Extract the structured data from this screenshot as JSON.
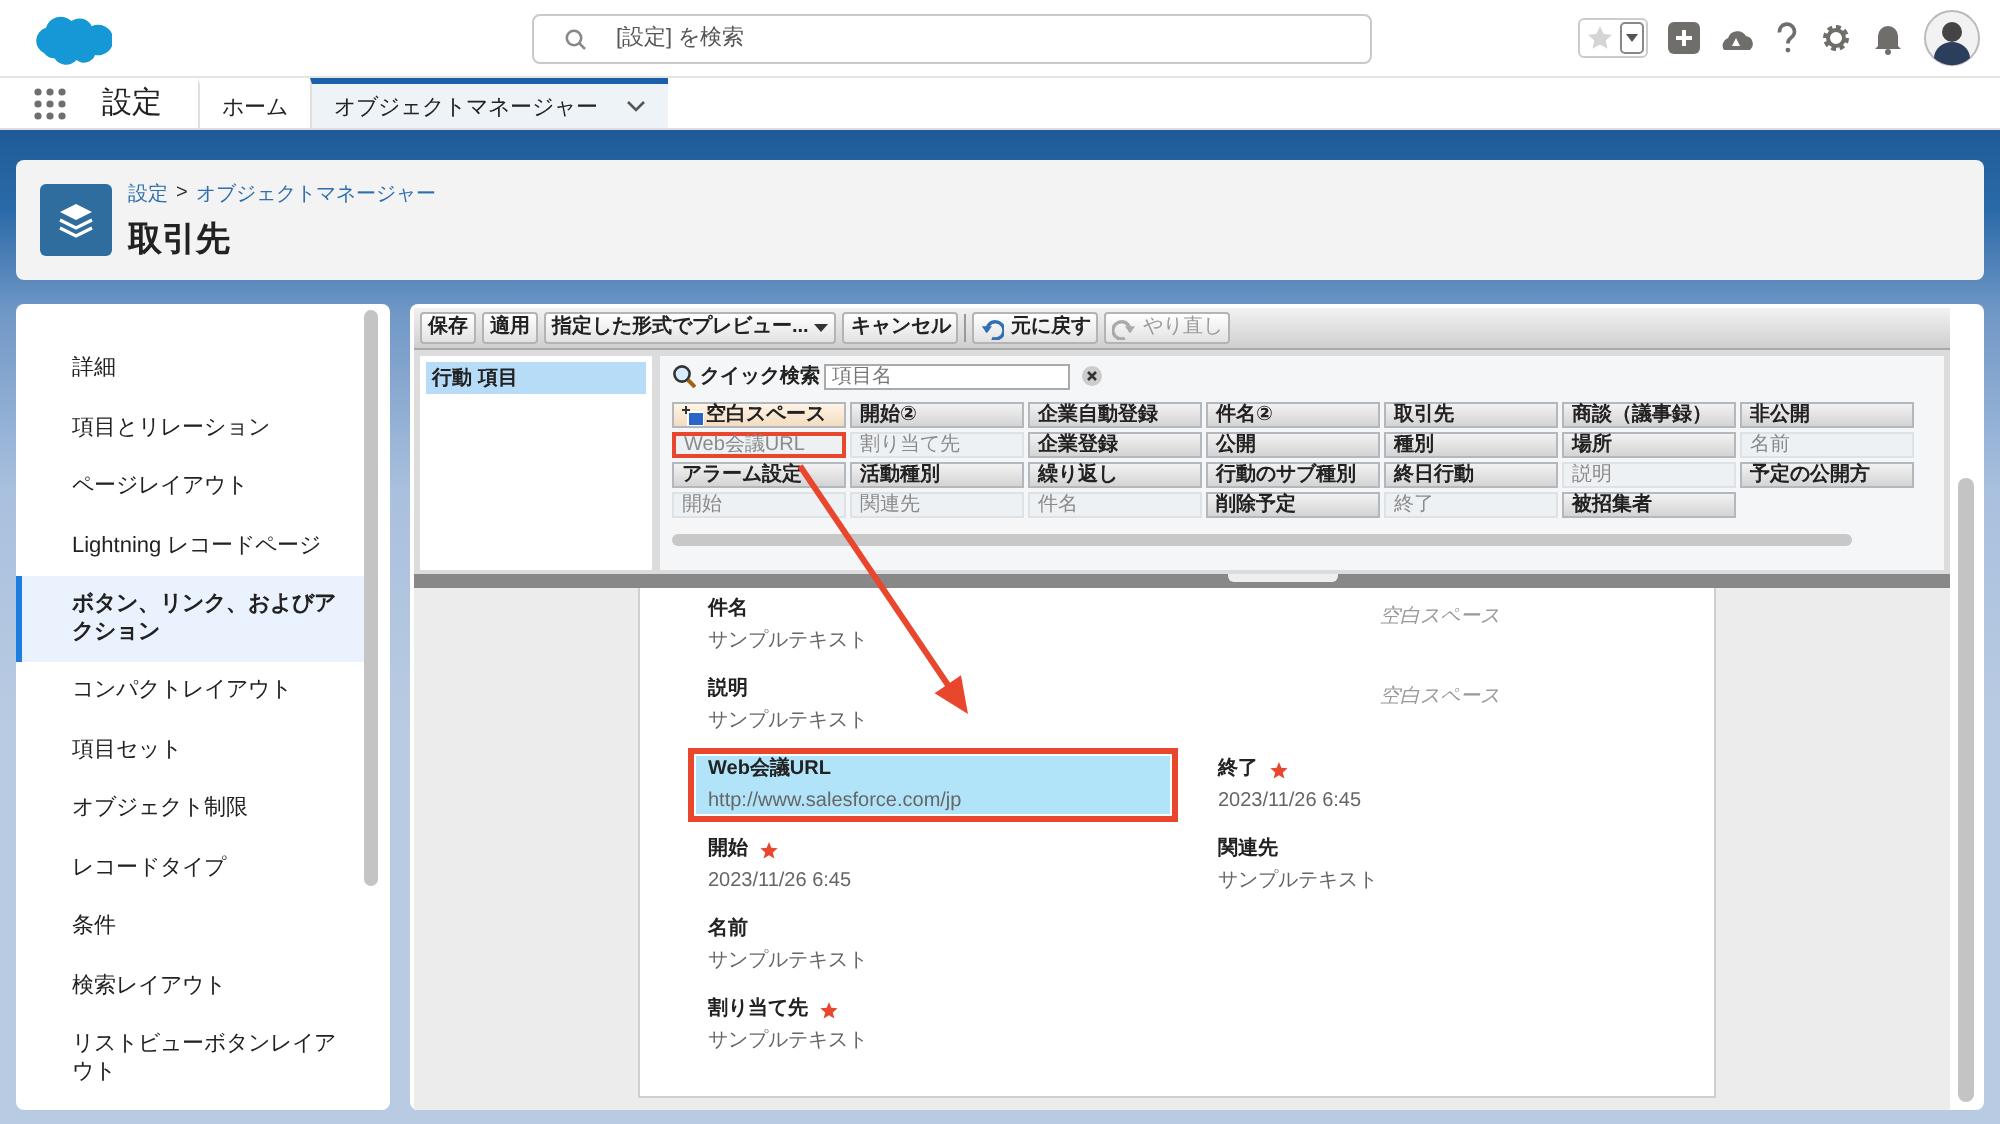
{
  "top_bar": {
    "search_placeholder": "[設定] を検索"
  },
  "nav": {
    "app_name": "設定",
    "tabs": [
      {
        "label": "ホーム",
        "selected": false,
        "has_menu": false
      },
      {
        "label": "オブジェクトマネージャー",
        "selected": true,
        "has_menu": true
      }
    ]
  },
  "page_header": {
    "breadcrumb": [
      "設定",
      "オブジェクトマネージャー"
    ],
    "separator": ">",
    "title": "取引先"
  },
  "sidebar": {
    "items": [
      {
        "label": "詳細",
        "selected": false
      },
      {
        "label": "項目とリレーション",
        "selected": false
      },
      {
        "label": "ページレイアウト",
        "selected": false
      },
      {
        "label": "Lightning レコードページ",
        "selected": false
      },
      {
        "label": "ボタン、リンク、およびアクション",
        "selected": true
      },
      {
        "label": "コンパクトレイアウト",
        "selected": false
      },
      {
        "label": "項目セット",
        "selected": false
      },
      {
        "label": "オブジェクト制限",
        "selected": false
      },
      {
        "label": "レコードタイプ",
        "selected": false
      },
      {
        "label": "条件",
        "selected": false
      },
      {
        "label": "検索レイアウト",
        "selected": false
      },
      {
        "label": "リストビューボタンレイアウト",
        "selected": false
      }
    ]
  },
  "palette": {
    "toolbar": [
      {
        "label": "保存",
        "kind": "button",
        "disabled": false
      },
      {
        "label": "適用",
        "kind": "button",
        "disabled": false
      },
      {
        "label": "指定した形式でプレビュー...",
        "kind": "dropdown",
        "disabled": false
      },
      {
        "label": "キャンセル",
        "kind": "button",
        "disabled": false
      },
      {
        "label": "元に戻す",
        "kind": "undo",
        "disabled": false
      },
      {
        "label": "やり直し",
        "kind": "redo",
        "disabled": true
      }
    ],
    "categories": [
      {
        "label": "行動 項目",
        "selected": true
      }
    ],
    "quick_search": {
      "label": "クイック検索",
      "placeholder": "項目名"
    },
    "items": [
      {
        "label": "空白スペース",
        "kind": "blank",
        "used": false,
        "annotated": false
      },
      {
        "label": "開始②",
        "kind": "field",
        "used": false,
        "annotated": false
      },
      {
        "label": "企業自動登録",
        "kind": "field",
        "used": false,
        "annotated": false
      },
      {
        "label": "件名②",
        "kind": "field",
        "used": false,
        "annotated": false
      },
      {
        "label": "取引先",
        "kind": "field",
        "used": false,
        "annotated": false
      },
      {
        "label": "商談（議事録）",
        "kind": "field",
        "used": false,
        "annotated": false
      },
      {
        "label": "非公開",
        "kind": "field",
        "used": false,
        "annotated": false
      },
      {
        "label": "Web会議URL",
        "kind": "field",
        "used": true,
        "annotated": true
      },
      {
        "label": "割り当て先",
        "kind": "field",
        "used": true,
        "annotated": false
      },
      {
        "label": "企業登録",
        "kind": "field",
        "used": false,
        "annotated": false
      },
      {
        "label": "公開",
        "kind": "field",
        "used": false,
        "annotated": false
      },
      {
        "label": "種別",
        "kind": "field",
        "used": false,
        "annotated": false
      },
      {
        "label": "場所",
        "kind": "field",
        "used": false,
        "annotated": false
      },
      {
        "label": "名前",
        "kind": "field",
        "used": true,
        "annotated": false
      },
      {
        "label": "アラーム設定",
        "kind": "field",
        "used": false,
        "annotated": false
      },
      {
        "label": "活動種別",
        "kind": "field",
        "used": false,
        "annotated": false
      },
      {
        "label": "繰り返し",
        "kind": "field",
        "used": false,
        "annotated": false
      },
      {
        "label": "行動のサブ種別",
        "kind": "field",
        "used": false,
        "annotated": false
      },
      {
        "label": "終日行動",
        "kind": "field",
        "used": false,
        "annotated": false
      },
      {
        "label": "説明",
        "kind": "field",
        "used": true,
        "annotated": false
      },
      {
        "label": "予定の公開方",
        "kind": "field",
        "used": false,
        "annotated": false
      },
      {
        "label": "開始",
        "kind": "field",
        "used": true,
        "annotated": false
      },
      {
        "label": "関連先",
        "kind": "field",
        "used": true,
        "annotated": false
      },
      {
        "label": "件名",
        "kind": "field",
        "used": true,
        "annotated": false
      },
      {
        "label": "削除予定",
        "kind": "field",
        "used": false,
        "annotated": false
      },
      {
        "label": "終了",
        "kind": "field",
        "used": true,
        "annotated": false
      },
      {
        "label": "被招集者",
        "kind": "field",
        "used": false,
        "annotated": false
      }
    ]
  },
  "layout": {
    "rows": [
      {
        "cells": [
          {
            "kind": "field",
            "label": "件名",
            "value": "サンプルテキスト",
            "required": false,
            "highlighted": false,
            "annotated": false
          },
          {
            "kind": "blank",
            "label": "空白スペース"
          }
        ]
      },
      {
        "cells": [
          {
            "kind": "field",
            "label": "説明",
            "value": "サンプルテキスト",
            "required": false,
            "highlighted": false,
            "annotated": false
          },
          {
            "kind": "blank",
            "label": "空白スペース"
          }
        ]
      },
      {
        "cells": [
          {
            "kind": "field",
            "label": "Web会議URL",
            "value": "http://www.salesforce.com/jp",
            "required": false,
            "highlighted": true,
            "annotated": true
          },
          {
            "kind": "field",
            "label": "終了",
            "value": "2023/11/26 6:45",
            "required": true,
            "highlighted": false,
            "annotated": false
          }
        ]
      },
      {
        "cells": [
          {
            "kind": "field",
            "label": "開始",
            "value": "2023/11/26 6:45",
            "required": true,
            "highlighted": false,
            "annotated": false
          },
          {
            "kind": "field",
            "label": "関連先",
            "value": "サンプルテキスト",
            "required": false,
            "highlighted": false,
            "annotated": false
          }
        ]
      },
      {
        "cells": [
          {
            "kind": "field",
            "label": "名前",
            "value": "サンプルテキスト",
            "required": false,
            "highlighted": false,
            "annotated": false
          }
        ]
      },
      {
        "cells": [
          {
            "kind": "field",
            "label": "割り当て先",
            "value": "サンプルテキスト",
            "required": true,
            "highlighted": false,
            "annotated": false
          }
        ]
      }
    ]
  }
}
